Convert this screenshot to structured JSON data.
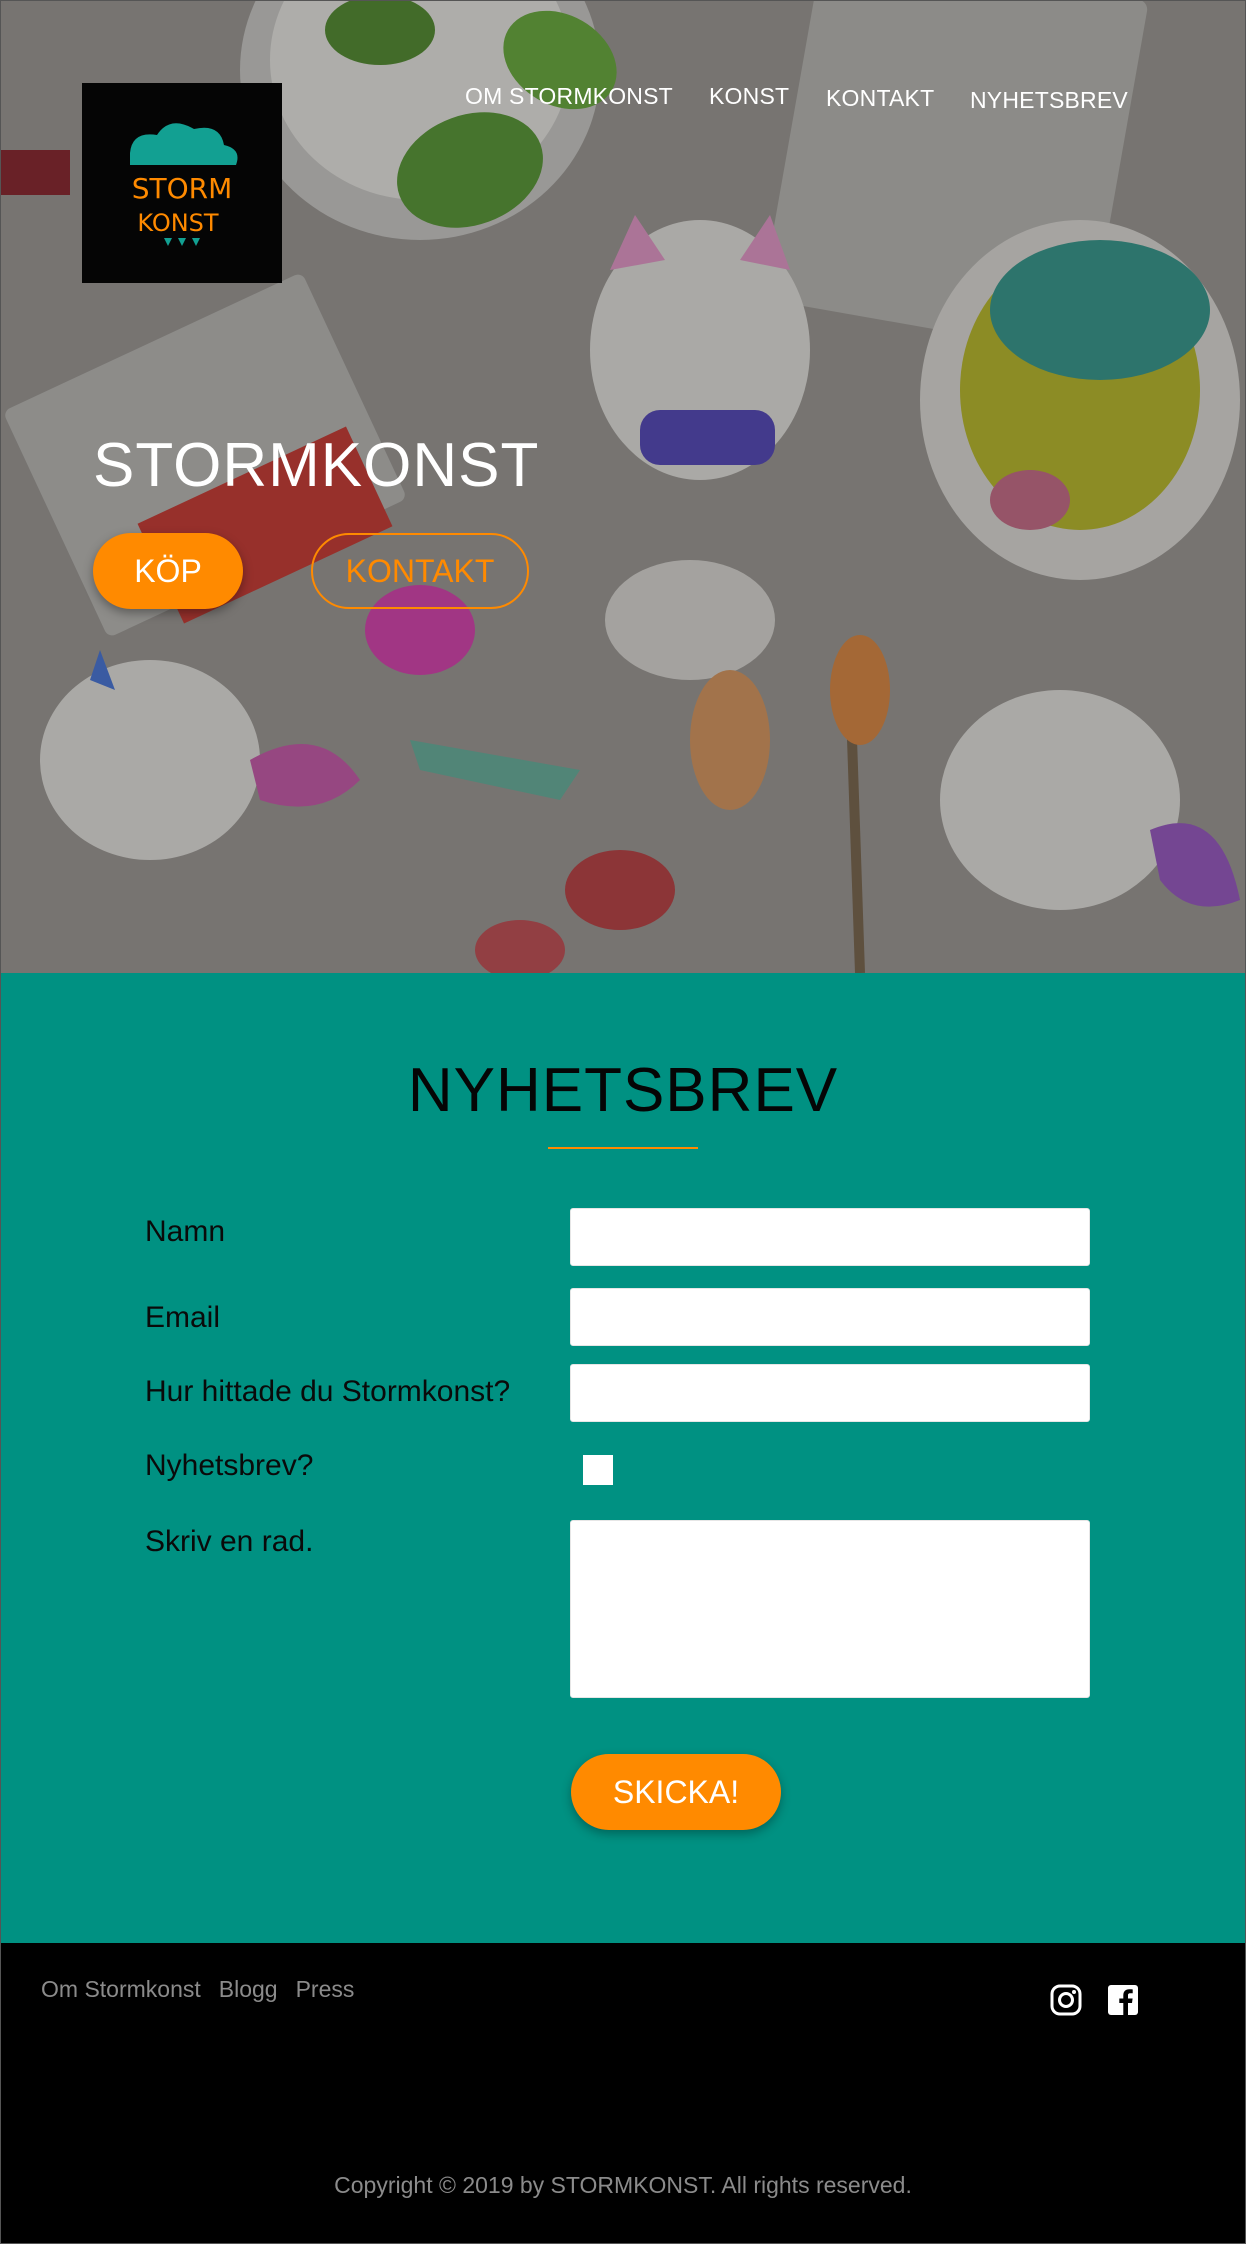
{
  "brand": {
    "logo_text_line1": "STORM",
    "logo_text_line2": "KONST",
    "colors": {
      "accent": "#ff8a00",
      "teal": "#009182",
      "footer": "#000000"
    }
  },
  "nav": {
    "items": [
      {
        "label": "OM STORMKONST"
      },
      {
        "label": "KONST"
      },
      {
        "label": "KONTAKT"
      },
      {
        "label": "NYHETSBREV"
      }
    ]
  },
  "hero": {
    "title": "STORMKONST",
    "buy_label": "KÖP",
    "contact_label": "KONTAKT"
  },
  "newsletter": {
    "title": "NYHETSBREV",
    "fields": {
      "name_label": "Namn",
      "email_label": "Email",
      "source_label": "Hur hittade du Stormkonst?",
      "subscribe_label": "Nyhetsbrev?",
      "message_label": "Skriv en rad.",
      "name_value": "",
      "email_value": "",
      "source_value": "",
      "message_value": ""
    },
    "submit_label": "SKICKA!"
  },
  "footer": {
    "links": [
      {
        "label": "Om Stormkonst"
      },
      {
        "label": "Blogg"
      },
      {
        "label": "Press"
      }
    ],
    "social": [
      {
        "icon": "instagram-icon"
      },
      {
        "icon": "facebook-icon"
      }
    ],
    "copyright": "Copyright © 2019 by STORMKONST. All rights reserved."
  }
}
